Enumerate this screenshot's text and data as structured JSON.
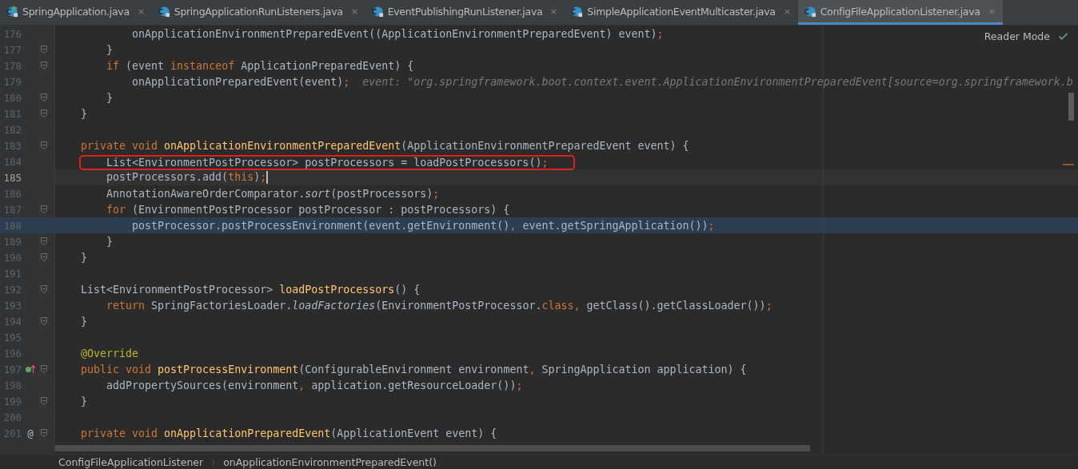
{
  "tabs": [
    {
      "label": "SpringApplication.java",
      "selected": false,
      "runnable": true
    },
    {
      "label": "SpringApplicationRunListeners.java",
      "selected": false,
      "runnable": false
    },
    {
      "label": "EventPublishingRunListener.java",
      "selected": false,
      "runnable": false
    },
    {
      "label": "SimpleApplicationEventMulticaster.java",
      "selected": false,
      "runnable": false
    },
    {
      "label": "ConfigFileApplicationListener.java",
      "selected": true,
      "runnable": false
    }
  ],
  "reader_mode": {
    "label": "Reader Mode"
  },
  "editor": {
    "lines": [
      {
        "number": "176",
        "fold": false,
        "current": false,
        "execution": false,
        "boxed": false,
        "tokens": [
          {
            "kind": "plain",
            "text": "        onApplicationEnvironmentPreparedEvent((ApplicationEnvironmentPreparedEvent) event)"
          },
          {
            "kind": "punct",
            "text": ";"
          }
        ]
      },
      {
        "number": "177",
        "fold": true,
        "current": false,
        "execution": false,
        "boxed": false,
        "tokens": [
          {
            "kind": "plain",
            "text": "    }"
          }
        ]
      },
      {
        "number": "178",
        "fold": true,
        "current": false,
        "execution": false,
        "boxed": false,
        "tokens": [
          {
            "kind": "keyword",
            "text": "    if"
          },
          {
            "kind": "plain",
            "text": " (event "
          },
          {
            "kind": "keyword",
            "text": "instanceof"
          },
          {
            "kind": "plain",
            "text": " ApplicationPreparedEvent) {"
          }
        ]
      },
      {
        "number": "179",
        "fold": false,
        "current": false,
        "execution": false,
        "boxed": false,
        "tokens": [
          {
            "kind": "plain",
            "text": "        onApplicationPreparedEvent(event)"
          },
          {
            "kind": "punct",
            "text": ";"
          },
          {
            "kind": "hint",
            "text": "  event: \"org.springframework.boot.context.event.ApplicationEnvironmentPreparedEvent[source=org.springframework.b"
          }
        ]
      },
      {
        "number": "180",
        "fold": true,
        "current": false,
        "execution": false,
        "boxed": false,
        "tokens": [
          {
            "kind": "plain",
            "text": "    }"
          }
        ]
      },
      {
        "number": "181",
        "fold": true,
        "current": false,
        "execution": false,
        "boxed": false,
        "tokens": [
          {
            "kind": "plain",
            "text": "}"
          }
        ]
      },
      {
        "number": "182",
        "fold": false,
        "current": false,
        "execution": false,
        "boxed": false
      },
      {
        "number": "183",
        "fold": true,
        "current": false,
        "execution": false,
        "boxed": false,
        "tokens": [
          {
            "kind": "keyword",
            "text": "private"
          },
          {
            "kind": "keyword",
            "text": " void"
          },
          {
            "kind": "decl",
            "text": " onApplicationEnvironmentPreparedEvent"
          },
          {
            "kind": "plain",
            "text": "(ApplicationEnvironmentPreparedEvent event) {"
          }
        ]
      },
      {
        "number": "184",
        "fold": false,
        "current": false,
        "execution": false,
        "boxed": true,
        "tokens": [
          {
            "kind": "plain",
            "text": "    List<EnvironmentPostProcessor> postProcessors = loadPostProcessors()"
          },
          {
            "kind": "punct",
            "text": ";"
          }
        ]
      },
      {
        "number": "185",
        "fold": false,
        "current": true,
        "execution": false,
        "boxed": false,
        "tokens": [
          {
            "kind": "plain",
            "text": "    postProcessors.add("
          },
          {
            "kind": "keyword",
            "text": "this"
          },
          {
            "kind": "plain",
            "text": ")"
          },
          {
            "kind": "punct",
            "text": ";"
          }
        ]
      },
      {
        "number": "186",
        "fold": false,
        "current": false,
        "execution": false,
        "boxed": false,
        "tokens": [
          {
            "kind": "plain",
            "text": "    AnnotationAwareOrderComparator."
          },
          {
            "kind": "static",
            "text": "sort"
          },
          {
            "kind": "plain",
            "text": "(postProcessors)"
          },
          {
            "kind": "punct",
            "text": ";"
          }
        ]
      },
      {
        "number": "187",
        "fold": true,
        "current": false,
        "execution": false,
        "boxed": false,
        "tokens": [
          {
            "kind": "keyword",
            "text": "    for"
          },
          {
            "kind": "plain",
            "text": " (EnvironmentPostProcessor postProcessor : postProcessors) {"
          }
        ]
      },
      {
        "number": "188",
        "fold": false,
        "current": false,
        "execution": true,
        "boxed": false,
        "tokens": [
          {
            "kind": "plain",
            "text": "        postProcessor.postProcessEnvironment(event.getEnvironment()"
          },
          {
            "kind": "punct",
            "text": ","
          },
          {
            "kind": "plain",
            "text": " event.getSpringApplication())"
          },
          {
            "kind": "punct",
            "text": ";"
          }
        ]
      },
      {
        "number": "189",
        "fold": true,
        "current": false,
        "execution": false,
        "boxed": false,
        "tokens": [
          {
            "kind": "plain",
            "text": "    }"
          }
        ]
      },
      {
        "number": "190",
        "fold": true,
        "current": false,
        "execution": false,
        "boxed": false,
        "tokens": [
          {
            "kind": "plain",
            "text": "}"
          }
        ]
      },
      {
        "number": "191",
        "fold": false,
        "current": false,
        "execution": false,
        "boxed": false
      },
      {
        "number": "192",
        "fold": true,
        "current": false,
        "execution": false,
        "boxed": false,
        "tokens": [
          {
            "kind": "plain",
            "text": "List<EnvironmentPostProcessor>"
          },
          {
            "kind": "decl",
            "text": " loadPostProcessors"
          },
          {
            "kind": "plain",
            "text": "() {"
          }
        ]
      },
      {
        "number": "193",
        "fold": false,
        "current": false,
        "execution": false,
        "boxed": false,
        "tokens": [
          {
            "kind": "keyword",
            "text": "    return"
          },
          {
            "kind": "plain",
            "text": " SpringFactoriesLoader."
          },
          {
            "kind": "static",
            "text": "loadFactories"
          },
          {
            "kind": "plain",
            "text": "(EnvironmentPostProcessor."
          },
          {
            "kind": "keyword",
            "text": "class"
          },
          {
            "kind": "punct",
            "text": ","
          },
          {
            "kind": "plain",
            "text": " getClass().getClassLoader())"
          },
          {
            "kind": "punct",
            "text": ";"
          }
        ]
      },
      {
        "number": "194",
        "fold": true,
        "current": false,
        "execution": false,
        "boxed": false,
        "tokens": [
          {
            "kind": "plain",
            "text": "}"
          }
        ]
      },
      {
        "number": "195",
        "fold": false,
        "current": false,
        "execution": false,
        "boxed": false
      },
      {
        "number": "196",
        "fold": false,
        "current": false,
        "execution": false,
        "boxed": false,
        "tokens": [
          {
            "kind": "annotation",
            "text": "@Override"
          }
        ]
      },
      {
        "number": "197",
        "fold": true,
        "current": false,
        "execution": false,
        "boxed": false,
        "badge": {
          "kind": "override"
        },
        "tokens": [
          {
            "kind": "keyword",
            "text": "public"
          },
          {
            "kind": "keyword",
            "text": " void"
          },
          {
            "kind": "decl",
            "text": " postProcessEnvironment"
          },
          {
            "kind": "plain",
            "text": "(ConfigurableEnvironment environment"
          },
          {
            "kind": "punct",
            "text": ","
          },
          {
            "kind": "plain",
            "text": " SpringApplication application) {"
          }
        ]
      },
      {
        "number": "198",
        "fold": false,
        "current": false,
        "execution": false,
        "boxed": false,
        "tokens": [
          {
            "kind": "plain",
            "text": "    addPropertySources(environment"
          },
          {
            "kind": "punct",
            "text": ","
          },
          {
            "kind": "plain",
            "text": " application.getResourceLoader())"
          },
          {
            "kind": "punct",
            "text": ";"
          }
        ]
      },
      {
        "number": "199",
        "fold": true,
        "current": false,
        "execution": false,
        "boxed": false,
        "tokens": [
          {
            "kind": "plain",
            "text": "}"
          }
        ]
      },
      {
        "number": "200",
        "fold": false,
        "current": false,
        "execution": false,
        "boxed": false
      },
      {
        "number": "201",
        "fold": true,
        "current": false,
        "execution": false,
        "boxed": false,
        "badge": {
          "kind": "at",
          "text": "@"
        },
        "tokens": [
          {
            "kind": "keyword",
            "text": "private"
          },
          {
            "kind": "keyword",
            "text": " void"
          },
          {
            "kind": "decl",
            "text": " onApplicationPreparedEvent"
          },
          {
            "kind": "plain",
            "text": "(ApplicationEvent event) {"
          }
        ]
      }
    ]
  },
  "breadcrumbs": [
    "ConfigFileApplicationListener",
    "onApplicationEnvironmentPreparedEvent()"
  ]
}
